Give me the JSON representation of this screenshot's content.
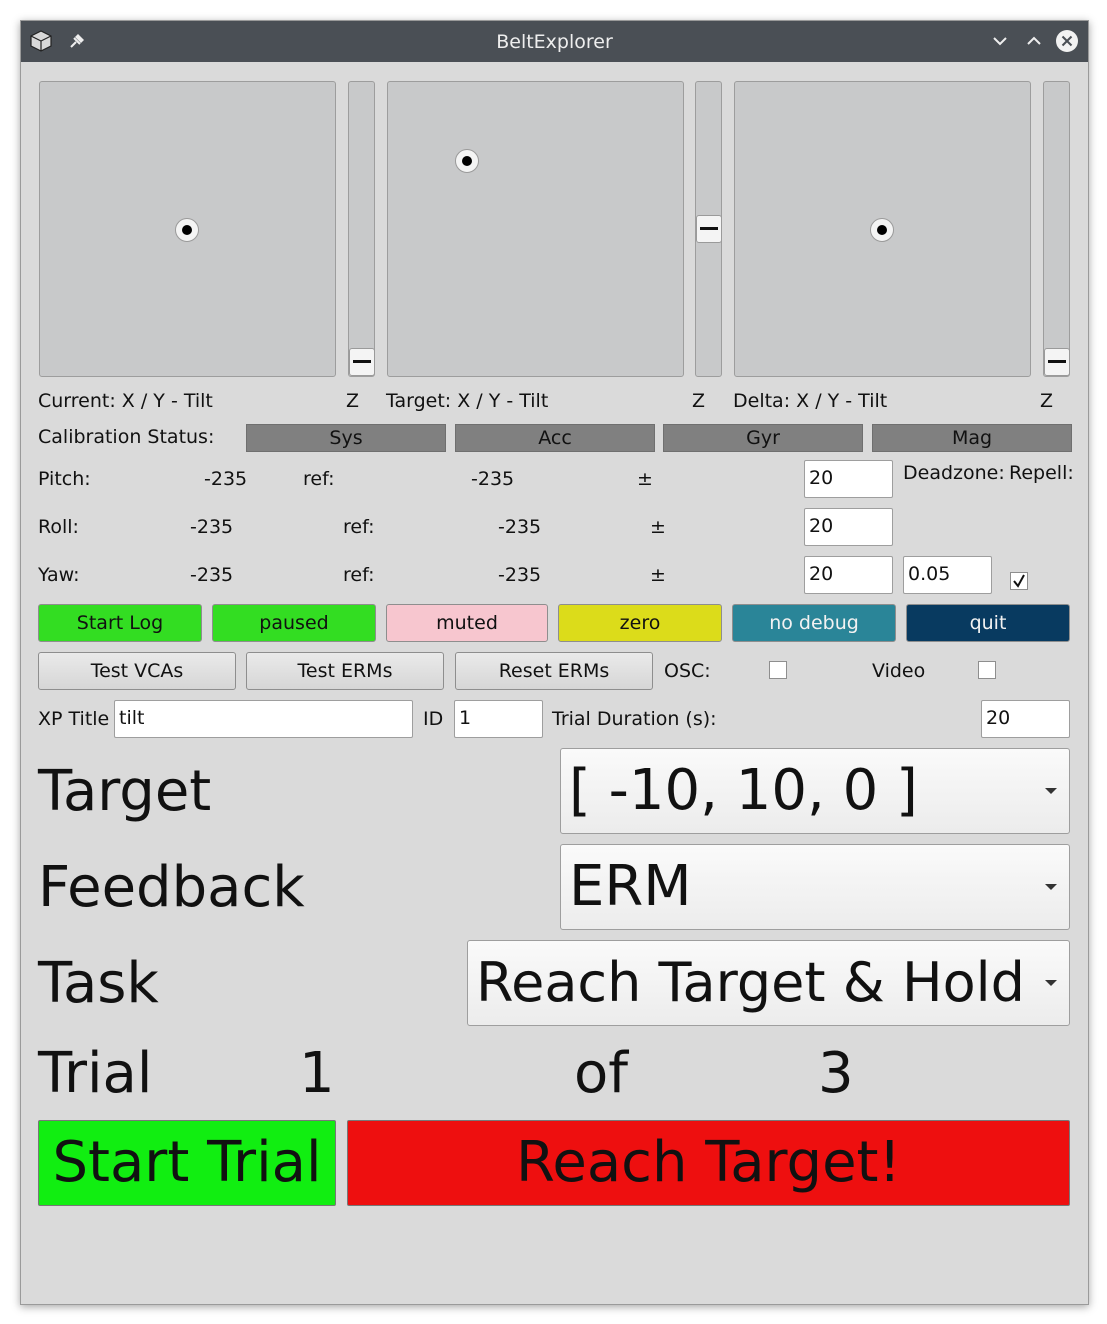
{
  "window": {
    "title": "BeltExplorer"
  },
  "pads": {
    "current_label": "Current: X / Y - Tilt",
    "target_label": "Target: X / Y - Tilt",
    "delta_label": "Delta: X / Y - Tilt",
    "z_label": "Z"
  },
  "calibration": {
    "label": "Calibration Status:",
    "items": [
      "Sys",
      "Acc",
      "Gyr",
      "Mag"
    ]
  },
  "orientation": {
    "pitch_label": "Pitch:",
    "roll_label": "Roll:",
    "yaw_label": "Yaw:",
    "pitch_value": "-235",
    "roll_value": "-235",
    "yaw_value": "-235",
    "ref_label": "ref:",
    "pitch_ref": "-235",
    "roll_ref": "-235",
    "yaw_ref": "-235",
    "pm": "±",
    "pitch_tol": "20",
    "roll_tol": "20",
    "yaw_tol": "20",
    "deadzone_label": "Deadzone:",
    "repell_label": "Repell:",
    "deadzone_value": "0.05",
    "repell_checked": true
  },
  "controls": {
    "start_log": "Start Log",
    "paused": "paused",
    "muted": "muted",
    "zero": "zero",
    "no_debug": "no debug",
    "quit": "quit",
    "test_vcas": "Test VCAs",
    "test_erms": "Test ERMs",
    "reset_erms": "Reset ERMs",
    "osc_label": "OSC:",
    "video_label": "Video"
  },
  "experiment": {
    "xp_title_label": "XP Title",
    "xp_title_value": "tilt",
    "id_label": "ID",
    "id_value": "1",
    "trial_duration_label": "Trial Duration (s):",
    "trial_duration_value": "20"
  },
  "settings": {
    "target_label": "Target",
    "target_value": "[ -10, 10, 0 ]",
    "feedback_label": "Feedback",
    "feedback_value": "ERM",
    "task_label": "Task",
    "task_value": "Reach Target & Hold"
  },
  "trial": {
    "label": "Trial",
    "current": "1",
    "of_label": "of",
    "total": "3",
    "start_button": "Start Trial",
    "status_button": "Reach Target!"
  },
  "colors": {
    "start_log": "#33dd22",
    "paused": "#33dd22",
    "muted": "#f7c6cf",
    "zero": "#dcdc1a",
    "no_debug": "#2a8598",
    "quit": "#083a60",
    "start_trial": "#11ee11",
    "reach_target": "#ee0f0f"
  }
}
